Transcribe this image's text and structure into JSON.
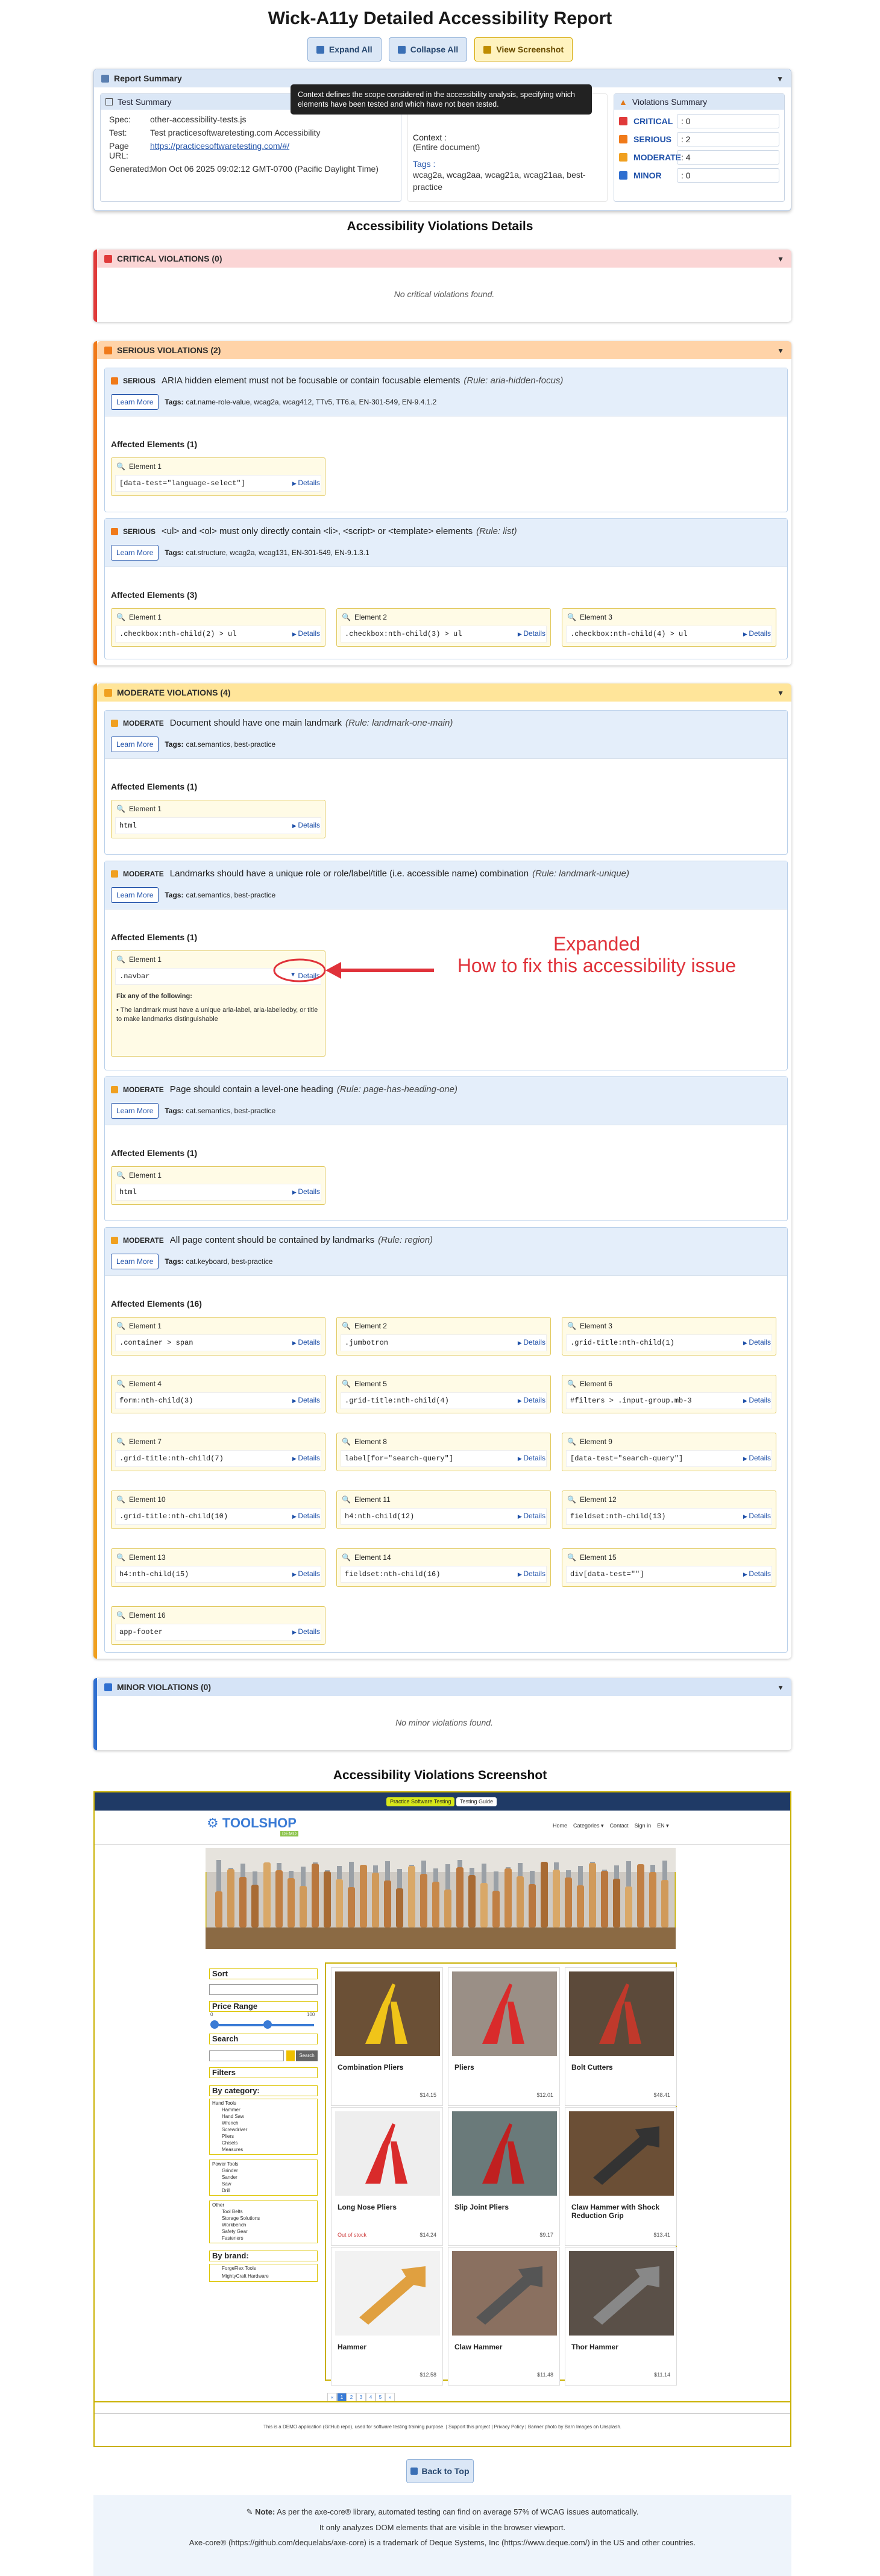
{
  "title": "Wick-A11y Detailed Accessibility Report",
  "buttons": {
    "expand": "Expand All",
    "collapse": "Collapse All",
    "screenshot": "View Screenshot",
    "back_to_top": "Back to Top"
  },
  "report_summary": {
    "header": "Report Summary",
    "test_summary": {
      "header": "Test Summary",
      "spec_label": "Spec:",
      "spec": "other-accessibility-tests.js",
      "test_label": "Test:",
      "test": "Test practicesoftwaretesting.com Accessibility",
      "url_label": "Page URL:",
      "url": "https://practicesoftwaretesting.com/#/",
      "gen_label": "Generated:",
      "generated": "Mon Oct 06 2025 09:02:12 GMT-0700 (Pacific Daylight Time)"
    },
    "context": {
      "label": "Context :",
      "value": "(Entire document)",
      "tags_label": "Tags :",
      "tags": "wcag2a, wcag2aa, wcag21a, wcag21aa, best-practice"
    },
    "tooltip": "Context defines the scope considered in the accessibility analysis, specifying which elements have been tested and which have not been tested.",
    "violations_summary": {
      "header": "Violations Summary",
      "items": [
        {
          "name": "CRITICAL",
          "count": ": 0",
          "color": "#e03a3a"
        },
        {
          "name": "SERIOUS",
          "count": ": 2",
          "color": "#f07a1a"
        },
        {
          "name": "MODERATE",
          "count": ": 4",
          "color": "#f0a020"
        },
        {
          "name": "MINOR",
          "count": ": 0",
          "color": "#2f6fd0"
        }
      ]
    }
  },
  "details_title": "Accessibility Violations Details",
  "critical": {
    "header": "CRITICAL VIOLATIONS (0)",
    "none": "No critical violations found."
  },
  "serious": {
    "header": "SERIOUS VIOLATIONS (2)",
    "v1": {
      "sev": "SERIOUS",
      "title": "ARIA hidden element must not be focusable or contain focusable elements",
      "rule": "(Rule: aria-hidden-focus)",
      "learn": "Learn More",
      "tags_label": "Tags:",
      "tags": "cat.name-role-value, wcag2a, wcag412, TTv5, TT6.a, EN-301-549, EN-9.4.1.2",
      "affected": "Affected Elements (1)",
      "els": [
        {
          "label": "Element 1",
          "sel": "[data-test=\"language-select\"]"
        }
      ]
    },
    "v2": {
      "sev": "SERIOUS",
      "title": "<ul> and <ol> must only directly contain <li>, <script> or <template> elements",
      "rule": "(Rule: list)",
      "learn": "Learn More",
      "tags_label": "Tags:",
      "tags": "cat.structure, wcag2a, wcag131, EN-301-549, EN-9.1.3.1",
      "affected": "Affected Elements (3)",
      "els": [
        {
          "label": "Element 1",
          "sel": ".checkbox:nth-child(2) > ul"
        },
        {
          "label": "Element 2",
          "sel": ".checkbox:nth-child(3) > ul"
        },
        {
          "label": "Element 3",
          "sel": ".checkbox:nth-child(4) > ul"
        }
      ]
    }
  },
  "moderate": {
    "header": "MODERATE VIOLATIONS (4)",
    "v1": {
      "sev": "MODERATE",
      "title": "Document should have one main landmark",
      "rule": "(Rule: landmark-one-main)",
      "learn": "Learn More",
      "tags_label": "Tags:",
      "tags": "cat.semantics, best-practice",
      "affected": "Affected Elements (1)",
      "els": [
        {
          "label": "Element 1",
          "sel": "html"
        }
      ]
    },
    "v2": {
      "sev": "MODERATE",
      "title": "Landmarks should have a unique role or role/label/title (i.e. accessible name) combination",
      "rule": "(Rule: landmark-unique)",
      "learn": "Learn More",
      "tags_label": "Tags:",
      "tags": "cat.semantics, best-practice",
      "affected": "Affected Elements (1)",
      "els": [
        {
          "label": "Element 1",
          "sel": ".navbar"
        }
      ],
      "fix_title": "Fix any of the following:",
      "fix_text": "• The landmark must have a unique aria-label, aria-labelledby, or title to make landmarks distinguishable"
    },
    "v3": {
      "sev": "MODERATE",
      "title": "Page should contain a level-one heading",
      "rule": "(Rule: page-has-heading-one)",
      "learn": "Learn More",
      "tags_label": "Tags:",
      "tags": "cat.semantics, best-practice",
      "affected": "Affected Elements (1)",
      "els": [
        {
          "label": "Element 1",
          "sel": "html"
        }
      ]
    },
    "v4": {
      "sev": "MODERATE",
      "title": "All page content should be contained by landmarks",
      "rule": "(Rule: region)",
      "learn": "Learn More",
      "tags_label": "Tags:",
      "tags": "cat.keyboard, best-practice",
      "affected": "Affected Elements (16)",
      "els": [
        {
          "label": "Element 1",
          "sel": ".container > span"
        },
        {
          "label": "Element 2",
          "sel": ".jumbotron"
        },
        {
          "label": "Element 3",
          "sel": ".grid-title:nth-child(1)"
        },
        {
          "label": "Element 4",
          "sel": "form:nth-child(3)"
        },
        {
          "label": "Element 5",
          "sel": ".grid-title:nth-child(4)"
        },
        {
          "label": "Element 6",
          "sel": "#filters > .input-group.mb-3"
        },
        {
          "label": "Element 7",
          "sel": ".grid-title:nth-child(7)"
        },
        {
          "label": "Element 8",
          "sel": "label[for=\"search-query\"]"
        },
        {
          "label": "Element 9",
          "sel": "[data-test=\"search-query\"]"
        },
        {
          "label": "Element 10",
          "sel": ".grid-title:nth-child(10)"
        },
        {
          "label": "Element 11",
          "sel": "h4:nth-child(12)"
        },
        {
          "label": "Element 12",
          "sel": "fieldset:nth-child(13)"
        },
        {
          "label": "Element 13",
          "sel": "h4:nth-child(15)"
        },
        {
          "label": "Element 14",
          "sel": "fieldset:nth-child(16)"
        },
        {
          "label": "Element 15",
          "sel": "div[data-test=\"\"]"
        },
        {
          "label": "Element 16",
          "sel": "app-footer"
        }
      ]
    }
  },
  "minor": {
    "header": "MINOR VIOLATIONS (0)",
    "none": "No minor violations found."
  },
  "details_label": "Details",
  "annotation": {
    "line1": "Expanded",
    "line2": "How to fix this accessibility issue",
    "color": "#e0323a"
  },
  "screenshot_title": "Accessibility Violations Screenshot",
  "shop": {
    "banner": "Practice Software Testing",
    "banner_btn": "Testing Guide",
    "logo": "TOOLSHOP",
    "logo_sub": "DEMO",
    "nav": [
      "Home",
      "Categories ▾",
      "Contact",
      "Sign in",
      "EN ▾"
    ],
    "sort": "Sort",
    "price_range": "Price Range",
    "price_min": "0",
    "price_max": "100",
    "search": "Search",
    "search_btn": "Search",
    "filters": "Filters",
    "by_category": "By category:",
    "hand_tools": "Hand Tools",
    "hand_items": [
      "Hammer",
      "Hand Saw",
      "Wrench",
      "Screwdriver",
      "Pliers",
      "Chisels",
      "Measures"
    ],
    "power_tools": "Power Tools",
    "power_items": [
      "Grinder",
      "Sander",
      "Saw",
      "Drill"
    ],
    "other": "Other",
    "other_items": [
      "Tool Belts",
      "Storage Solutions",
      "Workbench",
      "Safety Gear",
      "Fasteners"
    ],
    "by_brand": "By brand:",
    "brands": [
      "ForgeFlex Tools",
      "MightyCraft Hardware"
    ],
    "products": [
      {
        "name": "Combination Pliers",
        "price": "$14.15"
      },
      {
        "name": "Pliers",
        "price": "$12.01"
      },
      {
        "name": "Bolt Cutters",
        "price": "$48.41"
      },
      {
        "name": "Long Nose Pliers",
        "price": "$14.24",
        "oos": "Out of stock"
      },
      {
        "name": "Slip Joint Pliers",
        "price": "$9.17"
      },
      {
        "name": "Claw Hammer with Shock Reduction Grip",
        "price": "$13.41"
      },
      {
        "name": "Hammer",
        "price": "$12.58"
      },
      {
        "name": "Claw Hammer",
        "price": "$11.48"
      },
      {
        "name": "Thor Hammer",
        "price": "$11.14"
      }
    ],
    "pages": [
      "«",
      "1",
      "2",
      "3",
      "4",
      "5",
      "»"
    ],
    "footer": "This is a DEMO application (GitHub repo), used for software testing training purpose. | Support this project | Privacy Policy | Banner photo by Barn Images on Unsplash."
  },
  "note": {
    "label": "Note:",
    "line1": "As per the axe-core® library, automated testing can find on average 57% of WCAG issues automatically.",
    "line2": "It only analyzes DOM elements that are visible in the browser viewport.",
    "line3": "Axe-core® (https://github.com/dequelabs/axe-core) is a trademark of Deque Systems, Inc (https://www.deque.com/) in the US and other countries."
  }
}
